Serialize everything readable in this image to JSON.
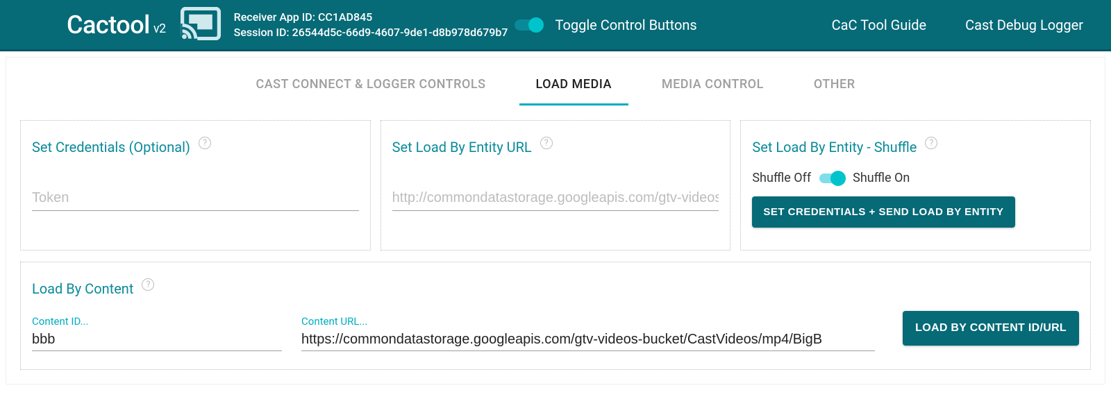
{
  "header": {
    "app_title": "Cactool",
    "app_version": "v2",
    "receiver_line": "Receiver App ID: CC1AD845",
    "session_line": "Session ID: 26544d5c-66d9-4607-9de1-d8b978d679b7",
    "toggle_label": "Toggle Control Buttons",
    "link_guide": "CaC Tool Guide",
    "link_logger": "Cast Debug Logger"
  },
  "tabs": {
    "items": [
      {
        "label": "CAST CONNECT & LOGGER CONTROLS",
        "active": false
      },
      {
        "label": "LOAD MEDIA",
        "active": true
      },
      {
        "label": "MEDIA CONTROL",
        "active": false
      },
      {
        "label": "OTHER",
        "active": false
      }
    ]
  },
  "panels": {
    "credentials": {
      "title": "Set Credentials (Optional)",
      "placeholder": "Token"
    },
    "entity_url": {
      "title": "Set Load By Entity URL",
      "placeholder": "http://commondatastorage.googleapis.com/gtv-videos-"
    },
    "shuffle": {
      "title": "Set Load By Entity - Shuffle",
      "off_label": "Shuffle Off",
      "on_label": "Shuffle On",
      "button": "SET CREDENTIALS + SEND LOAD BY ENTITY"
    }
  },
  "load_by_content": {
    "title": "Load By Content",
    "content_id_label": "Content ID...",
    "content_id_value": "bbb",
    "content_url_label": "Content URL...",
    "content_url_value": "https://commondatastorage.googleapis.com/gtv-videos-bucket/CastVideos/mp4/BigB",
    "button": "LOAD BY CONTENT ID/URL"
  }
}
